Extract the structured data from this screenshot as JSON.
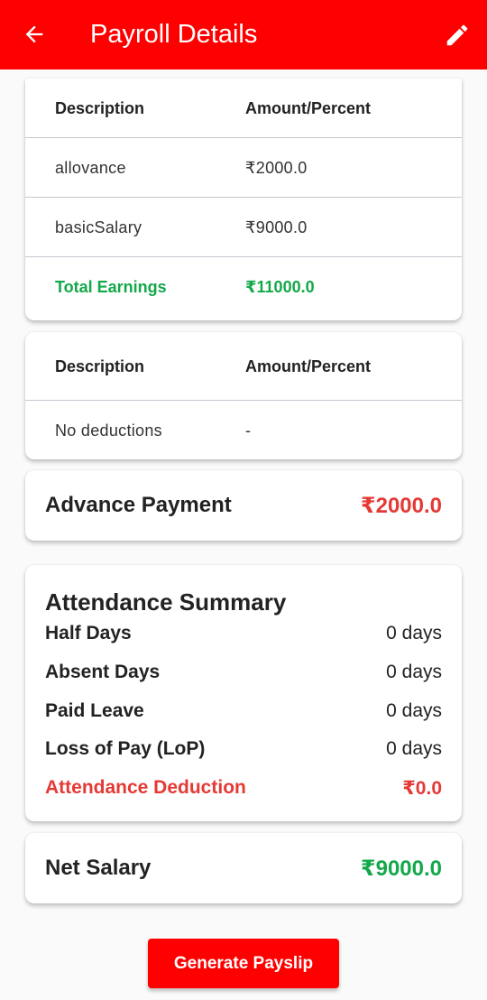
{
  "appbar": {
    "title": "Payroll Details",
    "back_icon": "arrow-left-icon",
    "edit_icon": "pencil-icon"
  },
  "earnings": {
    "headers": [
      "Description",
      "Amount/Percent"
    ],
    "rows": [
      {
        "description": "allovance",
        "amount": "₹2000.0"
      },
      {
        "description": "basicSalary",
        "amount": "₹9000.0"
      }
    ],
    "total": {
      "label": "Total Earnings",
      "amount": "₹11000.0"
    }
  },
  "deductions": {
    "headers": [
      "Description",
      "Amount/Percent"
    ],
    "rows": [
      {
        "description": "No deductions",
        "amount": "-"
      }
    ]
  },
  "advance": {
    "label": "Advance Payment",
    "amount": "₹2000.0"
  },
  "attendance": {
    "title": "Attendance Summary",
    "rows": [
      {
        "label": "Half Days",
        "value": "0 days"
      },
      {
        "label": "Absent Days",
        "value": "0 days"
      },
      {
        "label": "Paid Leave",
        "value": "0 days"
      },
      {
        "label": "Loss of Pay (LoP)",
        "value": "0 days"
      }
    ],
    "deduction": {
      "label": "Attendance Deduction",
      "value": "₹0.0"
    }
  },
  "net_salary": {
    "label": "Net Salary",
    "amount": "₹9000.0"
  },
  "actions": {
    "generate_label": "Generate Payslip"
  },
  "colors": {
    "primary": "#fe0000",
    "green": "#13a84a",
    "red": "#e53935"
  }
}
